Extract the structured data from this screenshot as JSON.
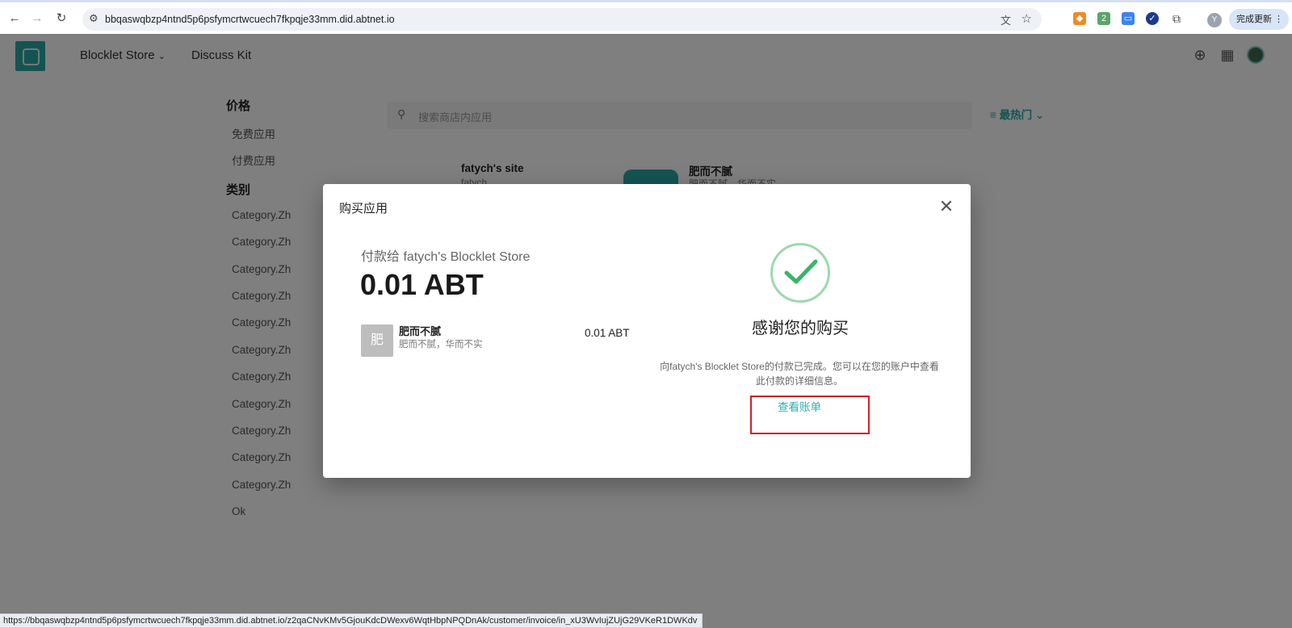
{
  "browser": {
    "url": "bbqaswqbzp4ntnd5p6psfymcrtwcuech7fkpqje33mm.did.abtnet.io",
    "profile_initial": "Y",
    "update_label": "完成更新",
    "extension_badge": "2",
    "status_url": "https://bbqaswqbzp4ntnd5p6psfymcrtwcuech7fkpqje33mm.did.abtnet.io/z2qaCNvKMv5GjouKdcDWexv6WqtHbpNPQDnAk/customer/invoice/in_xU3WvIujZUjG29VKeR1DWKdv"
  },
  "header": {
    "nav": [
      {
        "label": "Blocklet Store"
      },
      {
        "label": "Discuss Kit"
      }
    ]
  },
  "sidebar": {
    "price_title": "价格",
    "price_items": [
      "免费应用",
      "付费应用"
    ],
    "category_title": "类别",
    "category_items": [
      "Category.Zh",
      "Category.Zh",
      "Category.Zh",
      "Category.Zh",
      "Category.Zh",
      "Category.Zh",
      "Category.Zh",
      "Category.Zh",
      "Category.Zh",
      "Category.Zh",
      "Category.Zh",
      "Ok"
    ]
  },
  "search": {
    "placeholder": "搜索商店内应用"
  },
  "sort": {
    "label": "最热门"
  },
  "cards": [
    {
      "title": "fatych's site",
      "subtitle": "fatych"
    },
    {
      "title": "肥而不腻",
      "subtitle": "肥而不腻，华而不实"
    }
  ],
  "dialog": {
    "title": "购买应用",
    "pay_to": "付款给 fatych's Blocklet Store",
    "amount": "0.01 ABT",
    "item": {
      "thumb_char": "肥",
      "name": "肥而不腻",
      "description": "肥而不腻，华而不实",
      "price": "0.01 ABT"
    },
    "thanks": "感谢您的购买",
    "message": "向fatych's Blocklet Store的付款已完成。您可以在您的账户中查看此付款的详细信息。",
    "view_bill": "查看账单"
  },
  "colors": {
    "accent": "#2ba6a6",
    "success": "#3db36a",
    "highlight": "#d0202a"
  }
}
